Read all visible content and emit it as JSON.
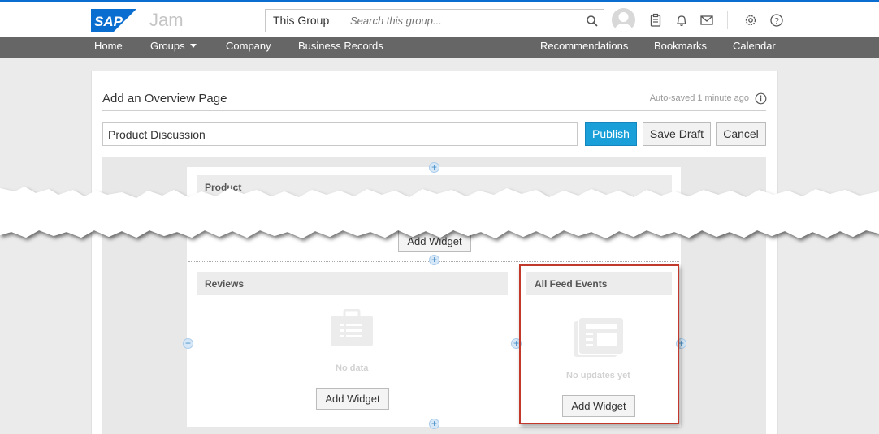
{
  "header": {
    "brand": "SAP",
    "product": "Jam",
    "scope_label": "This Group",
    "search_placeholder": "Search this group..."
  },
  "nav": {
    "items": [
      {
        "label": "Home"
      },
      {
        "label": "Groups"
      },
      {
        "label": "Company"
      },
      {
        "label": "Business Records"
      },
      {
        "label": "Recommendations"
      },
      {
        "label": "Bookmarks"
      },
      {
        "label": "Calendar"
      }
    ]
  },
  "editor": {
    "heading": "Add an Overview Page",
    "autosave_status": "Auto-saved 1 minute ago",
    "title_value": "Product Discussion",
    "publish_label": "Publish",
    "save_draft_label": "Save Draft",
    "cancel_label": "Cancel"
  },
  "widgets": {
    "top": {
      "title": "Product",
      "add_label": "Add Widget"
    },
    "reviews": {
      "title": "Reviews",
      "empty_text": "No data",
      "add_label": "Add Widget"
    },
    "feed": {
      "title": "All Feed Events",
      "empty_text": "No updates yet",
      "add_label": "Add Widget"
    }
  },
  "colors": {
    "accent": "#0a6ed1",
    "publish": "#1a9fd9",
    "nav_bg": "#666666",
    "highlight": "#c0392b"
  }
}
